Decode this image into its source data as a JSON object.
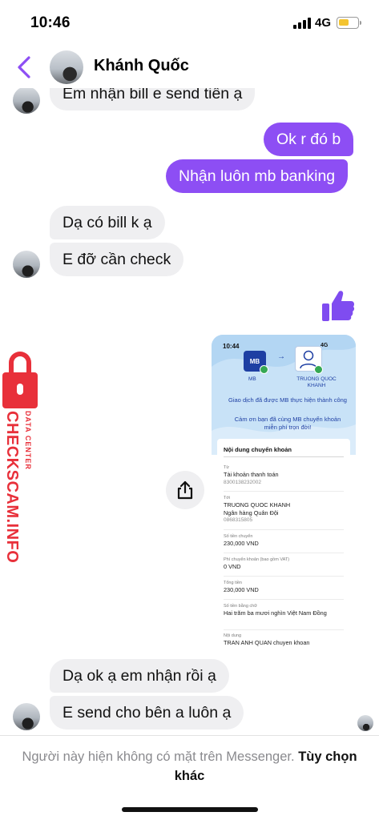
{
  "status_bar": {
    "time": "10:46",
    "network": "4G"
  },
  "header": {
    "contact_name": "Khánh Quốc"
  },
  "messages": [
    {
      "text": "Em nhận bill e send tiền ạ",
      "from": "them"
    },
    {
      "text": "Ok r đó b",
      "from": "me"
    },
    {
      "text": "Nhận luôn mb banking",
      "from": "me"
    },
    {
      "text": "Dạ có bill k ạ",
      "from": "them"
    },
    {
      "text": "E đỡ cần check",
      "from": "them"
    },
    {
      "text": "Dạ ok ạ em nhận rồi ạ",
      "from": "them"
    },
    {
      "text": "E send cho bên a luôn ạ",
      "from": "them"
    }
  ],
  "receipt": {
    "time": "10:44",
    "network": "4G",
    "bank_label": "MB",
    "bank_logo_text": "MB",
    "recipient_label": "TRUONG QUOC KHANH",
    "success_text": "Giao dịch đã được MB thực hiện thành công",
    "thanks_text": "Cảm ơn bạn đã cùng MB chuyển khoản miễn phí trọn đời!",
    "section_title": "Nội dung chuyển khoản",
    "from_label": "Từ",
    "from_value": "Tài khoản thanh toán",
    "from_account": "8300138232002",
    "to_label": "Tới",
    "to_name": "TRUONG QUOC KHANH",
    "to_bank": "Ngân hàng Quân Đội",
    "to_account": "0868315805",
    "amount_label": "Số tiền chuyển",
    "amount_value": "230,000 VND",
    "fee_label": "Phí chuyển khoản (bao gồm VAT)",
    "fee_value": "0 VND",
    "total_label": "Tổng tiền",
    "total_value": "230,000 VND",
    "words_label": "Số tiền bằng chữ",
    "words_value": "Hai trăm ba mươi nghìn Việt Nam Đồng",
    "content_label": "Nội dung",
    "content_value": "TRAN ANH QUAN chuyen khoan"
  },
  "watermark": {
    "line1": "DATA CENTER",
    "line2": "CHECKSCAM.INFO"
  },
  "footer": {
    "status_text": "Người này hiện không có mặt trên Messenger.",
    "link_text": "Tùy chọn khác"
  },
  "colors": {
    "accent": "#8d4ef4",
    "incoming_bubble": "#efeff1",
    "watermark_red": "#e8303a",
    "bank_blue": "#1e3fa3"
  },
  "icons": {
    "back": "chevron-left-icon",
    "like": "thumbs-up-icon",
    "share": "share-icon"
  }
}
